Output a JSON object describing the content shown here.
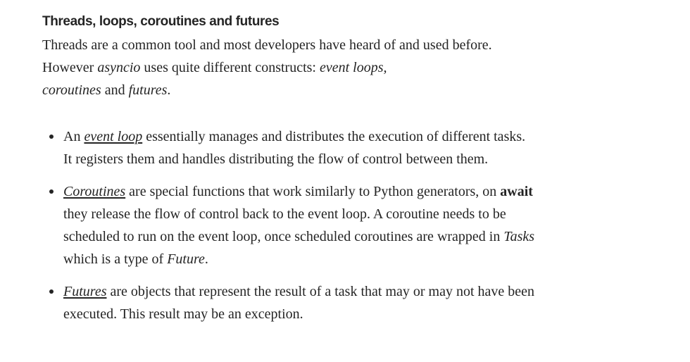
{
  "article": {
    "heading": "Threads, loops, coroutines and futures",
    "intro": {
      "t1": "Threads are a common tool and most developers have heard of and used before. However ",
      "e1": "asyncio",
      "t2": " uses quite different constructs: ",
      "e2": "event loops,",
      "t3": " ",
      "e3": "coroutines",
      "t4": " and ",
      "e4": "futures",
      "t5": "."
    },
    "bullets": {
      "event_loop": {
        "t1": "An ",
        "link": "event loop",
        "t2": " essentially manages and distributes the execution of different tasks. It registers them and handles distributing the flow of control between them."
      },
      "coroutines": {
        "link": "Coroutines",
        "t1": " are special functions that work similarly to Python generators, on ",
        "strong": "await",
        "t2": " they release the flow of control back to the event loop. A coroutine needs to be scheduled to run on the event loop, once scheduled coroutines are wrapped in ",
        "e1": "Tasks",
        "t3": " which is a type of ",
        "e2": "Future",
        "t4": "."
      },
      "futures": {
        "link": "Futures",
        "t1": " are objects that represent the result of a task that may or may not have been executed. This result may be an exception."
      }
    }
  }
}
